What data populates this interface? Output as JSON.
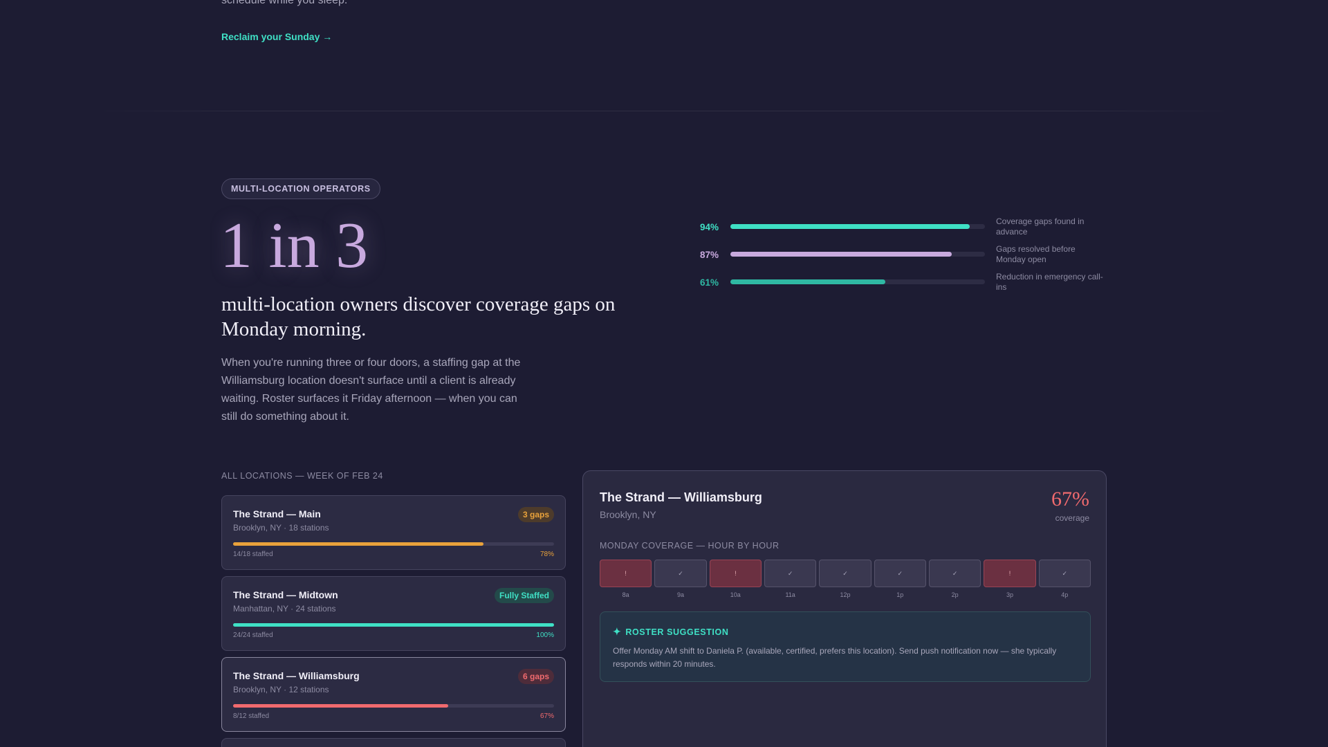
{
  "intro": {
    "tail_text": "schedule while you sleep.",
    "cta_label": "Reclaim your Sunday →"
  },
  "hero": {
    "badge": "MULTI-LOCATION OPERATORS",
    "stat": "1 in 3",
    "headline": "multi-location owners discover coverage gaps on Monday morning.",
    "body": "When you're running three or four doors, a staffing gap at the Williamsburg location doesn't surface until a client is already waiting. Roster surfaces it Friday afternoon — when you can still do something about it."
  },
  "metrics": [
    {
      "pct_label": "94%",
      "value": 0.94,
      "color": "#3fe0c5",
      "label": "Coverage gaps found in advance"
    },
    {
      "pct_label": "87%",
      "value": 0.87,
      "color": "#c8a9de",
      "label": "Gaps resolved before Monday open"
    },
    {
      "pct_label": "61%",
      "value": 0.61,
      "color": "#2fb8a3",
      "label": "Reduction in emergency call-ins"
    }
  ],
  "locations": {
    "heading": "ALL LOCATIONS — WEEK OF FEB 24",
    "items": [
      {
        "name": "The Strand — Main",
        "sub": "Brooklyn, NY · 18 stations",
        "pill": "3 gaps",
        "staffed": "14/18 staffed",
        "pct_label": "78%",
        "value": 0.78,
        "color": "#e9a23b",
        "pill_bg": "#4d3b2b"
      },
      {
        "name": "The Strand — Midtown",
        "sub": "Manhattan, NY · 24 stations",
        "pill": "Fully Staffed",
        "staffed": "24/24 staffed",
        "pct_label": "100%",
        "value": 1.0,
        "color": "#3fe0c5",
        "pill_bg": "#234a4a"
      },
      {
        "name": "The Strand — Williamsburg",
        "sub": "Brooklyn, NY · 12 stations",
        "pill": "6 gaps",
        "staffed": "8/12 staffed",
        "pct_label": "67%",
        "value": 0.67,
        "color": "#f06a6e",
        "pill_bg": "#4e2c3a"
      }
    ]
  },
  "detail": {
    "title": "The Strand — Williamsburg",
    "location": "Brooklyn, NY",
    "coverage_pct": "67%",
    "coverage_label": "coverage",
    "hour_heading": "MONDAY COVERAGE — HOUR BY HOUR",
    "hours": [
      {
        "label": "8a",
        "status": "!",
        "gap": true
      },
      {
        "label": "9a",
        "status": "✓",
        "gap": false
      },
      {
        "label": "10a",
        "status": "!",
        "gap": true
      },
      {
        "label": "11a",
        "status": "✓",
        "gap": false
      },
      {
        "label": "12p",
        "status": "✓",
        "gap": false
      },
      {
        "label": "1p",
        "status": "✓",
        "gap": false
      },
      {
        "label": "2p",
        "status": "✓",
        "gap": false
      },
      {
        "label": "3p",
        "status": "!",
        "gap": true
      },
      {
        "label": "4p",
        "status": "✓",
        "gap": false
      }
    ],
    "suggestion": {
      "icon": "sparkle-icon",
      "heading": "ROSTER SUGGESTION",
      "body": "Offer Monday AM shift to Daniela P. (available, certified, prefers this location). Send push notification now — she typically responds within 20 minutes."
    }
  }
}
